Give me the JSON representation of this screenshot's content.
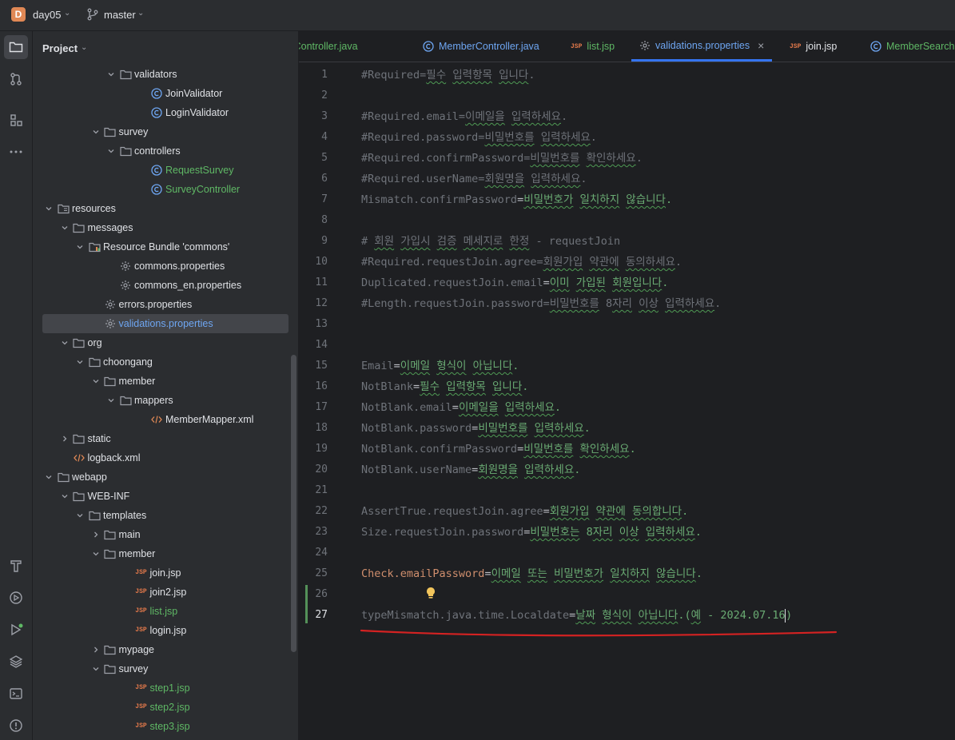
{
  "titlebar": {
    "project_initial": "D",
    "project_name": "day05",
    "branch": "master"
  },
  "toolwindow": {
    "title": "Project"
  },
  "tree": [
    {
      "label": "validators",
      "type": "folder",
      "depth": 6,
      "expanded": true
    },
    {
      "label": "JoinValidator",
      "type": "class",
      "depth": 8
    },
    {
      "label": "LoginValidator",
      "type": "class",
      "depth": 8
    },
    {
      "label": "survey",
      "type": "folder",
      "depth": 5,
      "expanded": true
    },
    {
      "label": "controllers",
      "type": "folder",
      "depth": 6,
      "expanded": true
    },
    {
      "label": "RequestSurvey",
      "type": "class",
      "depth": 8,
      "color": "green"
    },
    {
      "label": "SurveyController",
      "type": "class",
      "depth": 8,
      "color": "green"
    },
    {
      "label": "resources",
      "type": "resfolder",
      "depth": 2,
      "expanded": true
    },
    {
      "label": "messages",
      "type": "folder",
      "depth": 3,
      "expanded": true
    },
    {
      "label": "Resource Bundle 'commons'",
      "type": "bundle",
      "depth": 4,
      "expanded": true
    },
    {
      "label": "commons.properties",
      "type": "props",
      "depth": 6
    },
    {
      "label": "commons_en.properties",
      "type": "props",
      "depth": 6
    },
    {
      "label": "errors.properties",
      "type": "props",
      "depth": 5
    },
    {
      "label": "validations.properties",
      "type": "props",
      "depth": 5,
      "selected": true,
      "color": "blue"
    },
    {
      "label": "org",
      "type": "folder",
      "depth": 3,
      "expanded": true
    },
    {
      "label": "choongang",
      "type": "folder",
      "depth": 4,
      "expanded": true
    },
    {
      "label": "member",
      "type": "folder",
      "depth": 5,
      "expanded": true
    },
    {
      "label": "mappers",
      "type": "folder",
      "depth": 6,
      "expanded": true
    },
    {
      "label": "MemberMapper.xml",
      "type": "xml",
      "depth": 8
    },
    {
      "label": "static",
      "type": "folder",
      "depth": 3,
      "expanded": false
    },
    {
      "label": "logback.xml",
      "type": "xml",
      "depth": 3
    },
    {
      "label": "webapp",
      "type": "folder",
      "depth": 2,
      "expanded": true
    },
    {
      "label": "WEB-INF",
      "type": "folder",
      "depth": 3,
      "expanded": true
    },
    {
      "label": "templates",
      "type": "folder",
      "depth": 4,
      "expanded": true
    },
    {
      "label": "main",
      "type": "folder",
      "depth": 5,
      "expanded": false
    },
    {
      "label": "member",
      "type": "folder",
      "depth": 5,
      "expanded": true
    },
    {
      "label": "join.jsp",
      "type": "jsp",
      "depth": 7
    },
    {
      "label": "join2.jsp",
      "type": "jsp",
      "depth": 7
    },
    {
      "label": "list.jsp",
      "type": "jsp",
      "depth": 7,
      "color": "green"
    },
    {
      "label": "login.jsp",
      "type": "jsp",
      "depth": 7
    },
    {
      "label": "mypage",
      "type": "folder",
      "depth": 5,
      "expanded": false
    },
    {
      "label": "survey",
      "type": "folder",
      "depth": 5,
      "expanded": true
    },
    {
      "label": "step1.jsp",
      "type": "jsp",
      "depth": 7,
      "color": "green"
    },
    {
      "label": "step2.jsp",
      "type": "jsp",
      "depth": 7,
      "color": "green"
    },
    {
      "label": "step3.jsp",
      "type": "jsp",
      "depth": 7,
      "color": "green"
    }
  ],
  "tabs": [
    {
      "label": "rveyController.java",
      "type": "class",
      "color": "green"
    },
    {
      "label": "MemberController.java",
      "type": "class",
      "color": "blue"
    },
    {
      "label": "list.jsp",
      "type": "jsp",
      "color": "green"
    },
    {
      "label": "validations.properties",
      "type": "props",
      "color": "blue",
      "active": true,
      "closable": true
    },
    {
      "label": "join.jsp",
      "type": "jsp",
      "color": "normal"
    },
    {
      "label": "MemberSearch.java",
      "type": "class",
      "color": "green"
    }
  ],
  "close_glyph": "×",
  "editor": {
    "lines": [
      {
        "n": "1",
        "segs": [
          {
            "t": "#Required=필수 입력항목 입니다.",
            "c": "vc"
          }
        ]
      },
      {
        "n": "2",
        "segs": []
      },
      {
        "n": "3",
        "segs": [
          {
            "t": "#Required.email=이메일을 입력하세요.",
            "c": "vc"
          }
        ]
      },
      {
        "n": "4",
        "segs": [
          {
            "t": "#Required.password=비밀번호를 입력하세요.",
            "c": "vc"
          }
        ]
      },
      {
        "n": "5",
        "segs": [
          {
            "t": "#Required.confirmPassword=비밀번호를 확인하세요.",
            "c": "vc"
          }
        ]
      },
      {
        "n": "6",
        "segs": [
          {
            "t": "#Required.userName=회원명을 입력하세요.",
            "c": "vc"
          }
        ]
      },
      {
        "n": "7",
        "segs": [
          {
            "t": "Mismatch.confirmPassword",
            "c": "k"
          },
          {
            "t": "=",
            "c": "kp"
          },
          {
            "t": "비밀번호가 일치하지 않습니다.",
            "c": "v"
          }
        ]
      },
      {
        "n": "8",
        "segs": []
      },
      {
        "n": "9",
        "segs": [
          {
            "t": "# 회원 가입시 검증 메세지로 한정 - requestJoin",
            "c": "vc"
          }
        ]
      },
      {
        "n": "10",
        "segs": [
          {
            "t": "#Required.requestJoin.agree=회원가입 약관에 동의하세요.",
            "c": "vc"
          }
        ]
      },
      {
        "n": "11",
        "segs": [
          {
            "t": "Duplicated.requestJoin.email",
            "c": "k"
          },
          {
            "t": "=",
            "c": "kp"
          },
          {
            "t": "이미 가입된 회원입니다.",
            "c": "v"
          }
        ]
      },
      {
        "n": "12",
        "segs": [
          {
            "t": "#Length.requestJoin.password=비밀번호를 8자리 이상 입력하세요.",
            "c": "vc"
          }
        ]
      },
      {
        "n": "13",
        "segs": []
      },
      {
        "n": "14",
        "segs": []
      },
      {
        "n": "15",
        "segs": [
          {
            "t": "Email",
            "c": "k"
          },
          {
            "t": "=",
            "c": "kp"
          },
          {
            "t": "이메일 형식이 아닙니다.",
            "c": "v"
          }
        ]
      },
      {
        "n": "16",
        "segs": [
          {
            "t": "NotBlank",
            "c": "k"
          },
          {
            "t": "=",
            "c": "kp"
          },
          {
            "t": "필수 입력항목 입니다.",
            "c": "v"
          }
        ]
      },
      {
        "n": "17",
        "segs": [
          {
            "t": "NotBlank.email",
            "c": "k"
          },
          {
            "t": "=",
            "c": "kp"
          },
          {
            "t": "이메일을 입력하세요.",
            "c": "v"
          }
        ]
      },
      {
        "n": "18",
        "segs": [
          {
            "t": "NotBlank.password",
            "c": "k"
          },
          {
            "t": "=",
            "c": "kp"
          },
          {
            "t": "비밀번호를 입력하세요.",
            "c": "v"
          }
        ]
      },
      {
        "n": "19",
        "segs": [
          {
            "t": "NotBlank.confirmPassword",
            "c": "k"
          },
          {
            "t": "=",
            "c": "kp"
          },
          {
            "t": "비밀번호를 확인하세요.",
            "c": "v"
          }
        ]
      },
      {
        "n": "20",
        "segs": [
          {
            "t": "NotBlank.userName",
            "c": "k"
          },
          {
            "t": "=",
            "c": "kp"
          },
          {
            "t": "회원명을 입력하세요.",
            "c": "v"
          }
        ]
      },
      {
        "n": "21",
        "segs": []
      },
      {
        "n": "22",
        "segs": [
          {
            "t": "AssertTrue.requestJoin.agree",
            "c": "k"
          },
          {
            "t": "=",
            "c": "kp"
          },
          {
            "t": "회원가입 약관에 동의합니다.",
            "c": "v"
          }
        ]
      },
      {
        "n": "23",
        "segs": [
          {
            "t": "Size.requestJoin.password",
            "c": "k"
          },
          {
            "t": "=",
            "c": "kp"
          },
          {
            "t": "비밀번호는 8자리 이상 입력하세요.",
            "c": "v"
          }
        ]
      },
      {
        "n": "24",
        "segs": []
      },
      {
        "n": "25",
        "segs": [
          {
            "t": "Check.emailPassword",
            "c": "key-active"
          },
          {
            "t": "=",
            "c": "kp"
          },
          {
            "t": "이메일 또는 비밀번호가 일치하지 않습니다.",
            "c": "v"
          }
        ]
      },
      {
        "n": "26",
        "segs": []
      },
      {
        "n": "27",
        "segs": [
          {
            "t": "typeMismatch.java.time.Localdate",
            "c": "k"
          },
          {
            "t": "=",
            "c": "kp"
          },
          {
            "t": "날짜 형식이 아닙니다.(예 - 2024.07.16",
            "c": "v"
          },
          {
            "t": ")",
            "c": "v"
          }
        ],
        "current": true,
        "caret": true
      }
    ]
  },
  "colors": {
    "accent": "#3574f0",
    "green": "#5fb865",
    "blue": "#6ea6f2",
    "annotation_red": "#d42222"
  }
}
